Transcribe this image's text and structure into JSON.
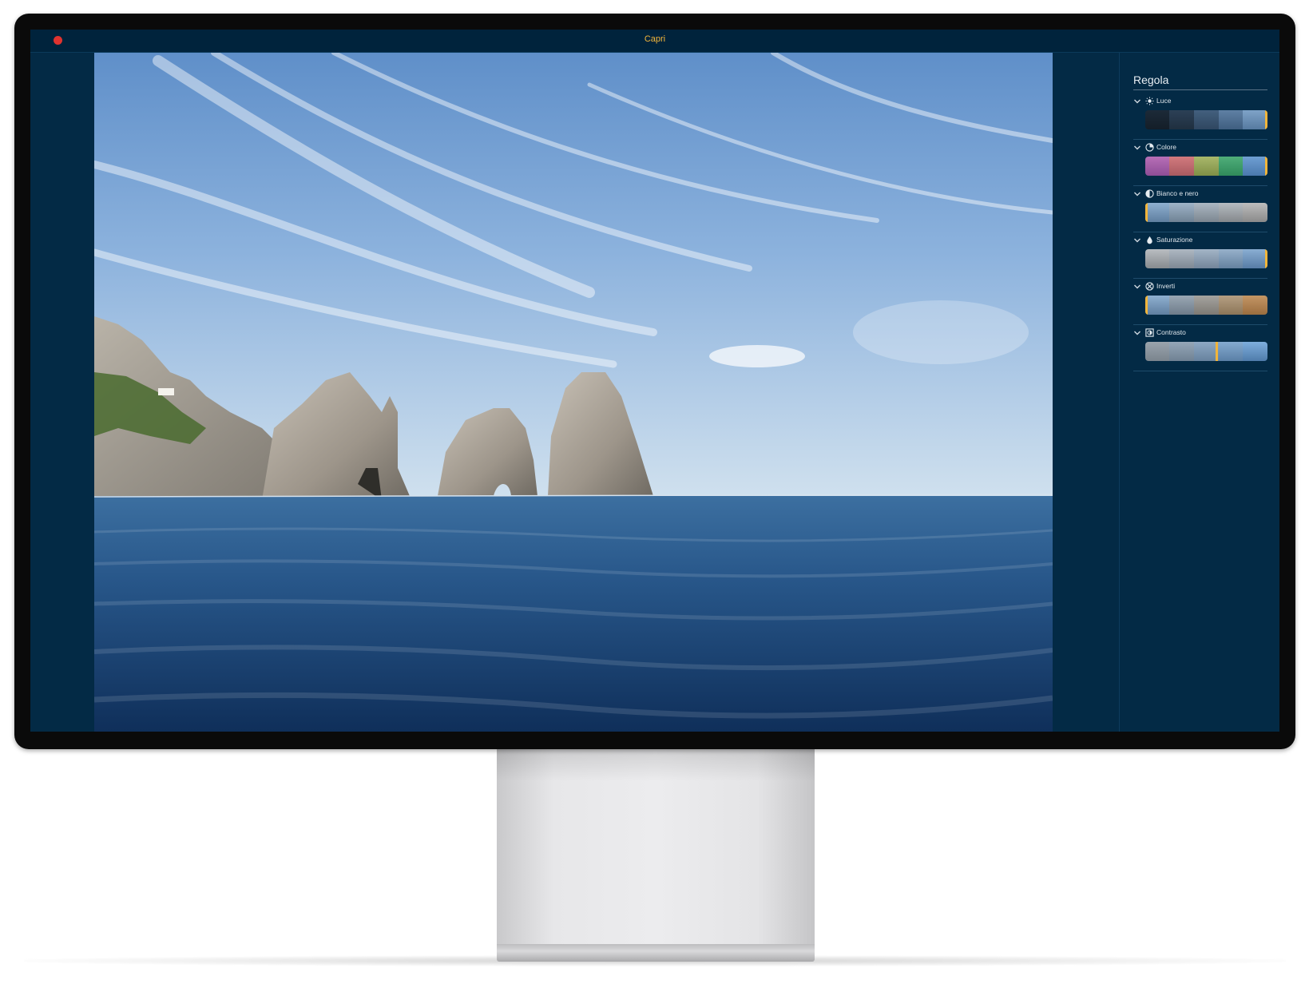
{
  "window": {
    "title": "Capri"
  },
  "panel": {
    "title": "Regola",
    "sections": [
      {
        "label": "Luce",
        "icon": "sun-icon",
        "marker": "end"
      },
      {
        "label": "Colore",
        "icon": "color-wheel-icon",
        "marker": "end"
      },
      {
        "label": "Bianco e nero",
        "icon": "half-circle-icon",
        "marker": "start"
      },
      {
        "label": "Saturazione",
        "icon": "drop-icon",
        "marker": "end"
      },
      {
        "label": "Inverti",
        "icon": "invert-icon",
        "marker": "start"
      },
      {
        "label": "Contrasto",
        "icon": "contrast-square-icon",
        "marker": "middle"
      }
    ]
  },
  "colors": {
    "accent": "#f2b53a",
    "window_bg": "#032a45",
    "titlebar_bg": "#00233c",
    "close_button": "#e0332f"
  }
}
